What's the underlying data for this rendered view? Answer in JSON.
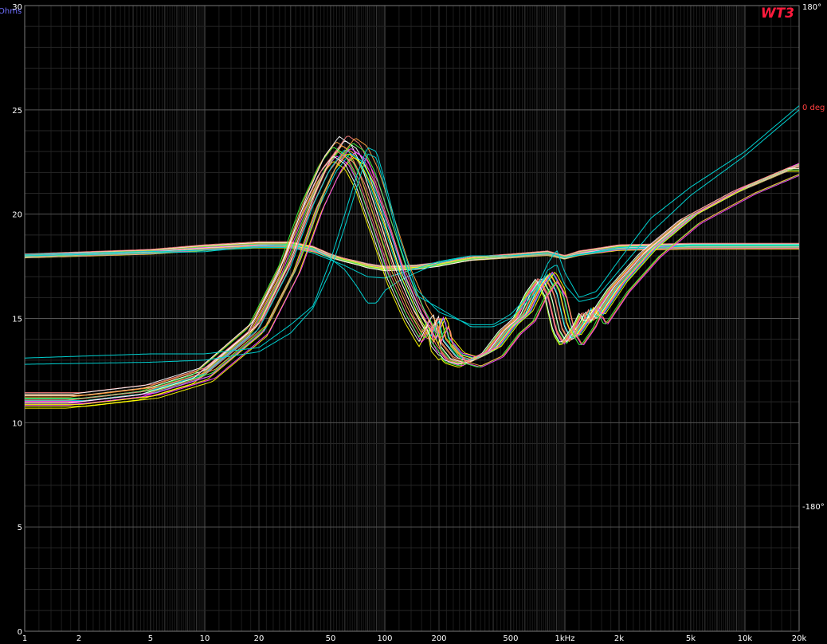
{
  "chart_data": {
    "type": "line",
    "title": "WT3",
    "ylabel": "Ohms",
    "y2label": "0 deg",
    "log_x": true,
    "grid": true,
    "xlim": [
      1,
      20000
    ],
    "ylim": [
      0,
      30
    ],
    "y2lim": [
      -270,
      180
    ],
    "x_ticks": [
      {
        "value": 1,
        "label": "1"
      },
      {
        "value": 2,
        "label": "2"
      },
      {
        "value": 5,
        "label": "5"
      },
      {
        "value": 10,
        "label": "10"
      },
      {
        "value": 20,
        "label": "20"
      },
      {
        "value": 50,
        "label": "50"
      },
      {
        "value": 100,
        "label": "100"
      },
      {
        "value": 200,
        "label": "200"
      },
      {
        "value": 500,
        "label": "500"
      },
      {
        "value": 1000,
        "label": "1kHz"
      },
      {
        "value": 2000,
        "label": "2k"
      },
      {
        "value": 5000,
        "label": "5k"
      },
      {
        "value": 10000,
        "label": "10k"
      },
      {
        "value": 20000,
        "label": "20k"
      }
    ],
    "y_ticks": [
      {
        "value": 0,
        "label": "0"
      },
      {
        "value": 5,
        "label": "5"
      },
      {
        "value": 10,
        "label": "10"
      },
      {
        "value": 15,
        "label": "15"
      },
      {
        "value": 20,
        "label": "20"
      },
      {
        "value": 25,
        "label": "25"
      },
      {
        "value": 30,
        "label": "30"
      }
    ],
    "y2_ticks": [
      {
        "value": 180,
        "label": "180°"
      },
      {
        "value": -180,
        "label": "-180°"
      }
    ],
    "colors": {
      "background": "#000000",
      "grid": "#3a3a3a",
      "grid_major": "#555555",
      "title": "#ff1a3c",
      "ylabel": "#6f6fff",
      "y2label": "#ff4040",
      "ticks": "#ffffff"
    },
    "series_colors": [
      "#00e0e0",
      "#ffff00",
      "#ff40ff",
      "#40ff40",
      "#ffa040",
      "#ffffff",
      "#ff8080"
    ],
    "impedance_group": {
      "base_points": [
        [
          1,
          11.1
        ],
        [
          2,
          11.1
        ],
        [
          5,
          11.5
        ],
        [
          10,
          12.3
        ],
        [
          20,
          14.5
        ],
        [
          30,
          17.5
        ],
        [
          40,
          20.5
        ],
        [
          50,
          22.3
        ],
        [
          60,
          23.2
        ],
        [
          70,
          22.8
        ],
        [
          80,
          21.8
        ],
        [
          100,
          19.3
        ],
        [
          120,
          17.2
        ],
        [
          150,
          15.3
        ],
        [
          180,
          14.1
        ],
        [
          200,
          14.9
        ],
        [
          210,
          13.9
        ],
        [
          250,
          13.1
        ],
        [
          300,
          12.9
        ],
        [
          400,
          13.4
        ],
        [
          500,
          14.5
        ],
        [
          600,
          15.1
        ],
        [
          700,
          16.3
        ],
        [
          800,
          17.0
        ],
        [
          900,
          16.2
        ],
        [
          1000,
          14.5
        ],
        [
          1100,
          13.9
        ],
        [
          1300,
          14.8
        ],
        [
          1400,
          15.4
        ],
        [
          1500,
          14.9
        ],
        [
          2000,
          16.5
        ],
        [
          3000,
          18.2
        ],
        [
          5000,
          19.8
        ],
        [
          10000,
          21.2
        ],
        [
          20000,
          22.3
        ]
      ],
      "count": 20
    },
    "impedance_cyan": [
      {
        "points": [
          [
            1,
            13.1
          ],
          [
            5,
            13.3
          ],
          [
            10,
            13.3
          ],
          [
            20,
            13.6
          ],
          [
            30,
            14.7
          ],
          [
            40,
            15.6
          ],
          [
            50,
            17.8
          ],
          [
            60,
            20.0
          ],
          [
            70,
            21.9
          ],
          [
            80,
            23.2
          ],
          [
            90,
            23.0
          ],
          [
            100,
            21.6
          ],
          [
            120,
            18.9
          ],
          [
            150,
            16.4
          ],
          [
            200,
            15.3
          ],
          [
            300,
            14.7
          ],
          [
            400,
            14.7
          ],
          [
            500,
            15.2
          ],
          [
            700,
            16.5
          ],
          [
            800,
            17.6
          ],
          [
            900,
            18.3
          ],
          [
            1000,
            17.2
          ],
          [
            1200,
            16.0
          ],
          [
            1500,
            16.3
          ],
          [
            2000,
            17.8
          ],
          [
            3000,
            19.8
          ],
          [
            5000,
            21.3
          ],
          [
            10000,
            23.0
          ],
          [
            20000,
            25.2
          ]
        ]
      },
      {
        "points": [
          [
            1,
            12.8
          ],
          [
            5,
            12.9
          ],
          [
            10,
            13.0
          ],
          [
            20,
            13.4
          ],
          [
            30,
            14.3
          ],
          [
            40,
            15.5
          ],
          [
            50,
            17.3
          ],
          [
            60,
            19.4
          ],
          [
            70,
            21.3
          ],
          [
            80,
            22.9
          ],
          [
            90,
            22.7
          ],
          [
            100,
            21.3
          ],
          [
            120,
            18.6
          ],
          [
            150,
            16.1
          ],
          [
            200,
            15.5
          ],
          [
            300,
            14.6
          ],
          [
            400,
            14.6
          ],
          [
            500,
            15.0
          ],
          [
            700,
            16.3
          ],
          [
            800,
            17.3
          ],
          [
            900,
            17.6
          ],
          [
            1000,
            16.6
          ],
          [
            1200,
            15.8
          ],
          [
            1500,
            16.0
          ],
          [
            2000,
            17.3
          ],
          [
            3000,
            19.1
          ],
          [
            5000,
            20.9
          ],
          [
            10000,
            22.8
          ],
          [
            20000,
            25.0
          ]
        ]
      }
    ],
    "phase_group": {
      "base_points": [
        [
          1,
          0
        ],
        [
          5,
          3
        ],
        [
          10,
          6
        ],
        [
          20,
          8
        ],
        [
          30,
          8
        ],
        [
          40,
          5
        ],
        [
          50,
          0
        ],
        [
          60,
          -3
        ],
        [
          70,
          -5
        ],
        [
          80,
          -7
        ],
        [
          100,
          -9
        ],
        [
          150,
          -8
        ],
        [
          200,
          -6
        ],
        [
          300,
          -2
        ],
        [
          500,
          0
        ],
        [
          800,
          2
        ],
        [
          1000,
          -1
        ],
        [
          1200,
          2
        ],
        [
          2000,
          6
        ],
        [
          5000,
          7
        ],
        [
          20000,
          7
        ]
      ],
      "count": 20
    },
    "phase_cyan": [
      {
        "points": [
          [
            1,
            0
          ],
          [
            10,
            3
          ],
          [
            20,
            7
          ],
          [
            30,
            8
          ],
          [
            40,
            5
          ],
          [
            50,
            -2
          ],
          [
            60,
            -10
          ],
          [
            70,
            -22
          ],
          [
            80,
            -34
          ],
          [
            90,
            -34
          ],
          [
            100,
            -25
          ],
          [
            120,
            -18
          ],
          [
            150,
            -12
          ],
          [
            200,
            -5
          ],
          [
            300,
            0
          ],
          [
            500,
            0
          ],
          [
            800,
            2
          ],
          [
            1000,
            -1
          ],
          [
            1200,
            1
          ],
          [
            2000,
            6
          ],
          [
            5000,
            8
          ],
          [
            20000,
            8
          ]
        ]
      },
      {
        "points": [
          [
            1,
            1
          ],
          [
            10,
            4
          ],
          [
            20,
            6
          ],
          [
            30,
            6
          ],
          [
            40,
            2
          ],
          [
            60,
            -7
          ],
          [
            80,
            -15
          ],
          [
            100,
            -16
          ],
          [
            150,
            -9
          ],
          [
            200,
            -4
          ],
          [
            300,
            0
          ],
          [
            500,
            0
          ],
          [
            800,
            2
          ],
          [
            1000,
            -1
          ],
          [
            2000,
            5
          ],
          [
            5000,
            7
          ],
          [
            20000,
            7
          ]
        ]
      }
    ]
  }
}
